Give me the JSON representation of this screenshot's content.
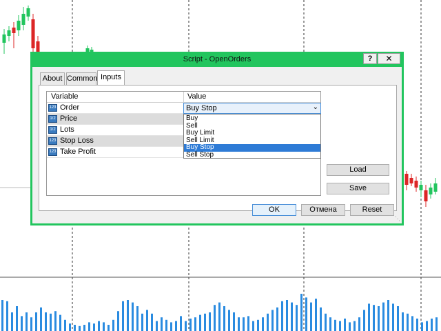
{
  "window": {
    "title": "Script - OpenOrders",
    "help_label": "?",
    "close_label": "✕"
  },
  "tabs": [
    {
      "label": "About",
      "active": false
    },
    {
      "label": "Common",
      "active": false
    },
    {
      "label": "Inputs",
      "active": true
    }
  ],
  "inputs_table": {
    "columns": [
      "Variable",
      "Value"
    ],
    "rows": [
      {
        "icon": "type-123-icon",
        "icon_text": "123",
        "variable": "Order"
      },
      {
        "icon": "type-decimal-icon",
        "icon_text": "1/2",
        "variable": "Price"
      },
      {
        "icon": "type-decimal-icon",
        "icon_text": "1/2",
        "variable": "Lots"
      },
      {
        "icon": "type-123-icon",
        "icon_text": "123",
        "variable": "Stop Loss"
      },
      {
        "icon": "type-123-icon",
        "icon_text": "123",
        "variable": "Take Profit"
      }
    ]
  },
  "order_select": {
    "selected": "Buy Stop",
    "options": [
      "Buy",
      "Sell",
      "Buy Limit",
      "Sell Limit",
      "Buy Stop",
      "Sell Stop"
    ],
    "highlighted_index": 4
  },
  "side_buttons": {
    "load": "Load",
    "save": "Save"
  },
  "footer_buttons": {
    "ok": "OK",
    "cancel": "Отмена",
    "reset": "Reset"
  },
  "colors": {
    "dialog_border": "#22c55e",
    "bull_candle": "#22c55e",
    "bear_candle": "#dc2626",
    "volume": "#2a8be0"
  }
}
